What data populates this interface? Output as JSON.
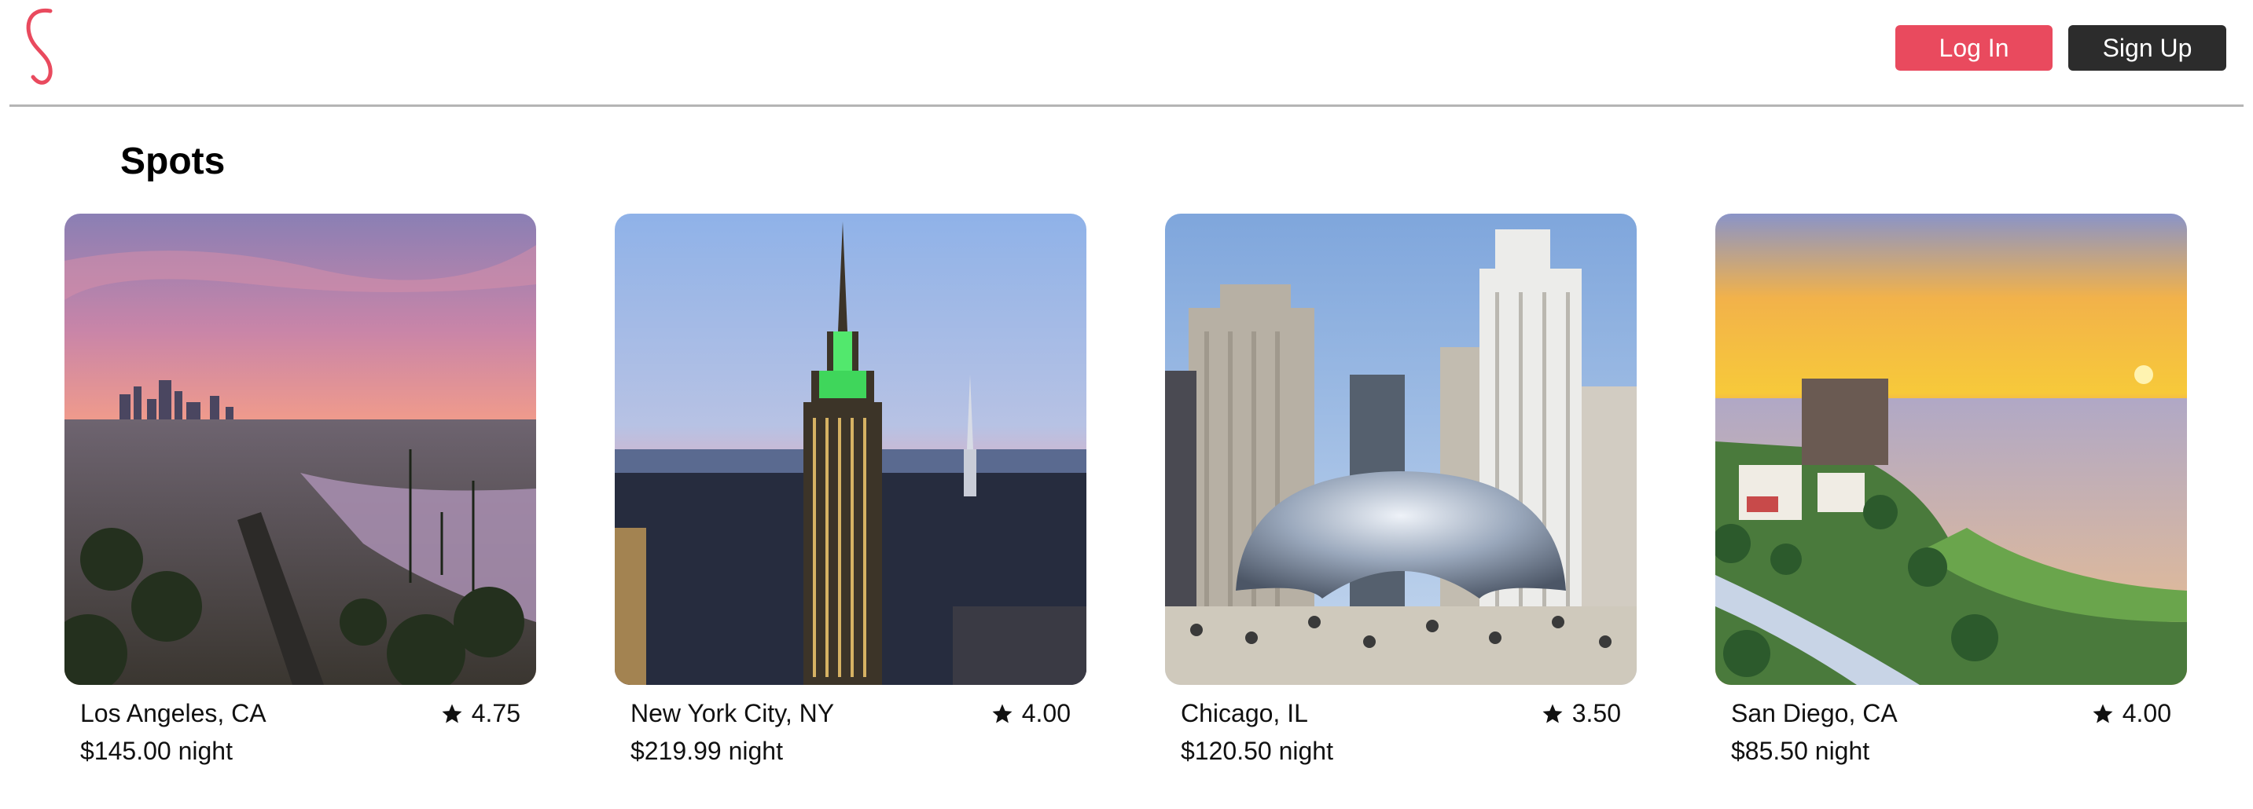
{
  "header": {
    "login_label": "Log In",
    "signup_label": "Sign Up",
    "logo_icon": "s-logo-icon",
    "accent_color": "#e94a5e",
    "dark_color": "#2c2c2c"
  },
  "page": {
    "title": "Spots"
  },
  "spots": [
    {
      "location": "Los Angeles, CA",
      "rating": "4.75",
      "price": "$145.00 night",
      "image": "los-angeles-sunset-photo"
    },
    {
      "location": "New York City, NY",
      "rating": "4.00",
      "price": "$219.99 night",
      "image": "new-york-skyline-photo"
    },
    {
      "location": "Chicago, IL",
      "rating": "3.50",
      "price": "$120.50 night",
      "image": "chicago-bean-photo"
    },
    {
      "location": "San Diego, CA",
      "rating": "4.00",
      "price": "$85.50 night",
      "image": "san-diego-coast-photo"
    }
  ]
}
